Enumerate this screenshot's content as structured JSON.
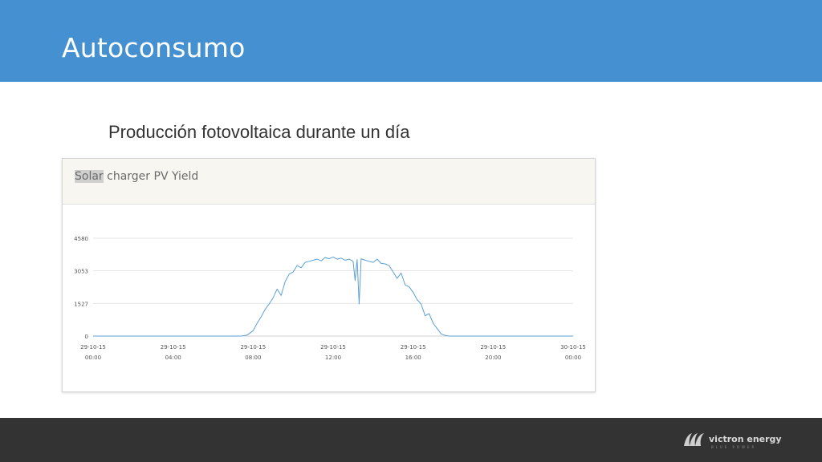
{
  "header": {
    "title": "Autoconsumo"
  },
  "subtitle": "Producción fotovoltaica durante un día",
  "panel": {
    "title_highlight": "Solar",
    "title_rest": " charger PV Yield"
  },
  "chart_data": {
    "type": "line",
    "title": "Solar charger PV Yield",
    "xlabel": "",
    "ylabel": "",
    "ylim": [
      0,
      4580
    ],
    "y_ticks": [
      "0",
      "1527",
      "3053",
      "4580"
    ],
    "x_ticks": [
      {
        "date": "29-10-15",
        "time": "00:00"
      },
      {
        "date": "29-10-15",
        "time": "04:00"
      },
      {
        "date": "29-10-15",
        "time": "08:00"
      },
      {
        "date": "29-10-15",
        "time": "12:00"
      },
      {
        "date": "29-10-15",
        "time": "16:00"
      },
      {
        "date": "29-10-15",
        "time": "20:00"
      },
      {
        "date": "30-10-15",
        "time": "00:00"
      }
    ],
    "grid": true,
    "color": "#5b9fd6",
    "series": [
      {
        "x": [
          0,
          1,
          2,
          3,
          4,
          5,
          6,
          7,
          7.4,
          7.7,
          8.0,
          8.2,
          8.4,
          8.6,
          8.8,
          9.0,
          9.2,
          9.4,
          9.6,
          9.8,
          10.0,
          10.2,
          10.4,
          10.6,
          10.8,
          11.0,
          11.2,
          11.4,
          11.6,
          11.8,
          12.0,
          12.2,
          12.4,
          12.6,
          12.8,
          13.0,
          13.1,
          13.2,
          13.3,
          13.4,
          13.6,
          13.8,
          14.0,
          14.2,
          14.4,
          14.6,
          14.8,
          15.0,
          15.2,
          15.4,
          15.6,
          15.8,
          16.0,
          16.2,
          16.4,
          16.6,
          16.8,
          17.0,
          17.2,
          17.4,
          17.6,
          17.8,
          18,
          19,
          20,
          21,
          22,
          23,
          24
        ],
        "y": [
          0,
          0,
          0,
          0,
          0,
          0,
          0,
          0,
          0,
          50,
          250,
          600,
          900,
          1250,
          1500,
          1800,
          2200,
          1900,
          2550,
          2900,
          3000,
          3300,
          3200,
          3450,
          3500,
          3550,
          3600,
          3520,
          3680,
          3620,
          3700,
          3600,
          3650,
          3550,
          3600,
          3500,
          2600,
          3580,
          1500,
          3620,
          3550,
          3500,
          3450,
          3600,
          3400,
          3380,
          3300,
          3000,
          2700,
          2950,
          2400,
          2300,
          2050,
          1700,
          1500,
          950,
          1050,
          600,
          350,
          100,
          30,
          0,
          0,
          0,
          0,
          0,
          0,
          0,
          0
        ]
      }
    ]
  },
  "footer": {
    "logo_text": "victron energy",
    "logo_sub": "BLUE POWER"
  },
  "colors": {
    "header": "#4490d0",
    "footer": "#333333",
    "line": "#5b9fd6",
    "grid": "#e4e4e4"
  },
  "icons": {
    "logo": "victron-logo-icon"
  }
}
